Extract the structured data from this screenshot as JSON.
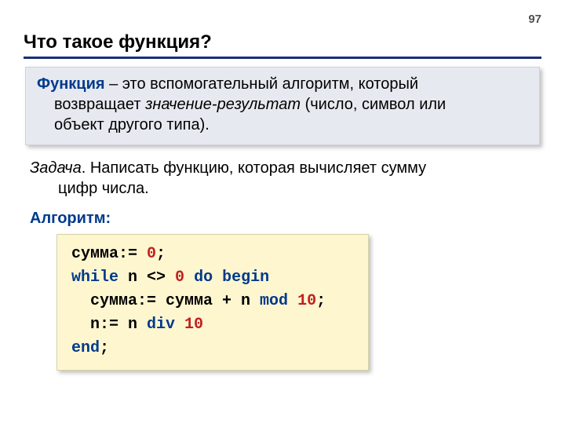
{
  "pageNumber": "97",
  "title": "Что такое функция?",
  "definition": {
    "term": "Функция",
    "line1_after_term": " – это вспомогательный алгоритм, который",
    "line2_pre": "возвращает ",
    "line2_em": "значение-результат",
    "line2_post": " (число, символ или",
    "line3": "объект другого типа)."
  },
  "task": {
    "label": "Задача",
    "line1_rest": ". Написать функцию, которая вычисляет сумму",
    "line2": "цифр числа."
  },
  "algoLabel": "Алгоритм:",
  "code": {
    "l1_a": "сумма:= ",
    "l1_num": "0",
    "l1_b": ";",
    "l2_kw1": "while",
    "l2_mid": " n <> ",
    "l2_num": "0",
    "l2_sp": " ",
    "l2_kw2": "do",
    "l2_sp2": " ",
    "l2_kw3": "begin",
    "l3_a": "  сумма:= сумма + n ",
    "l3_kw": "mod",
    "l3_sp": " ",
    "l3_num": "10",
    "l3_b": ";",
    "l4_a": "  n:= n ",
    "l4_kw": "div",
    "l4_sp": " ",
    "l4_num": "10",
    "l5_kw": "end",
    "l5_b": ";"
  }
}
